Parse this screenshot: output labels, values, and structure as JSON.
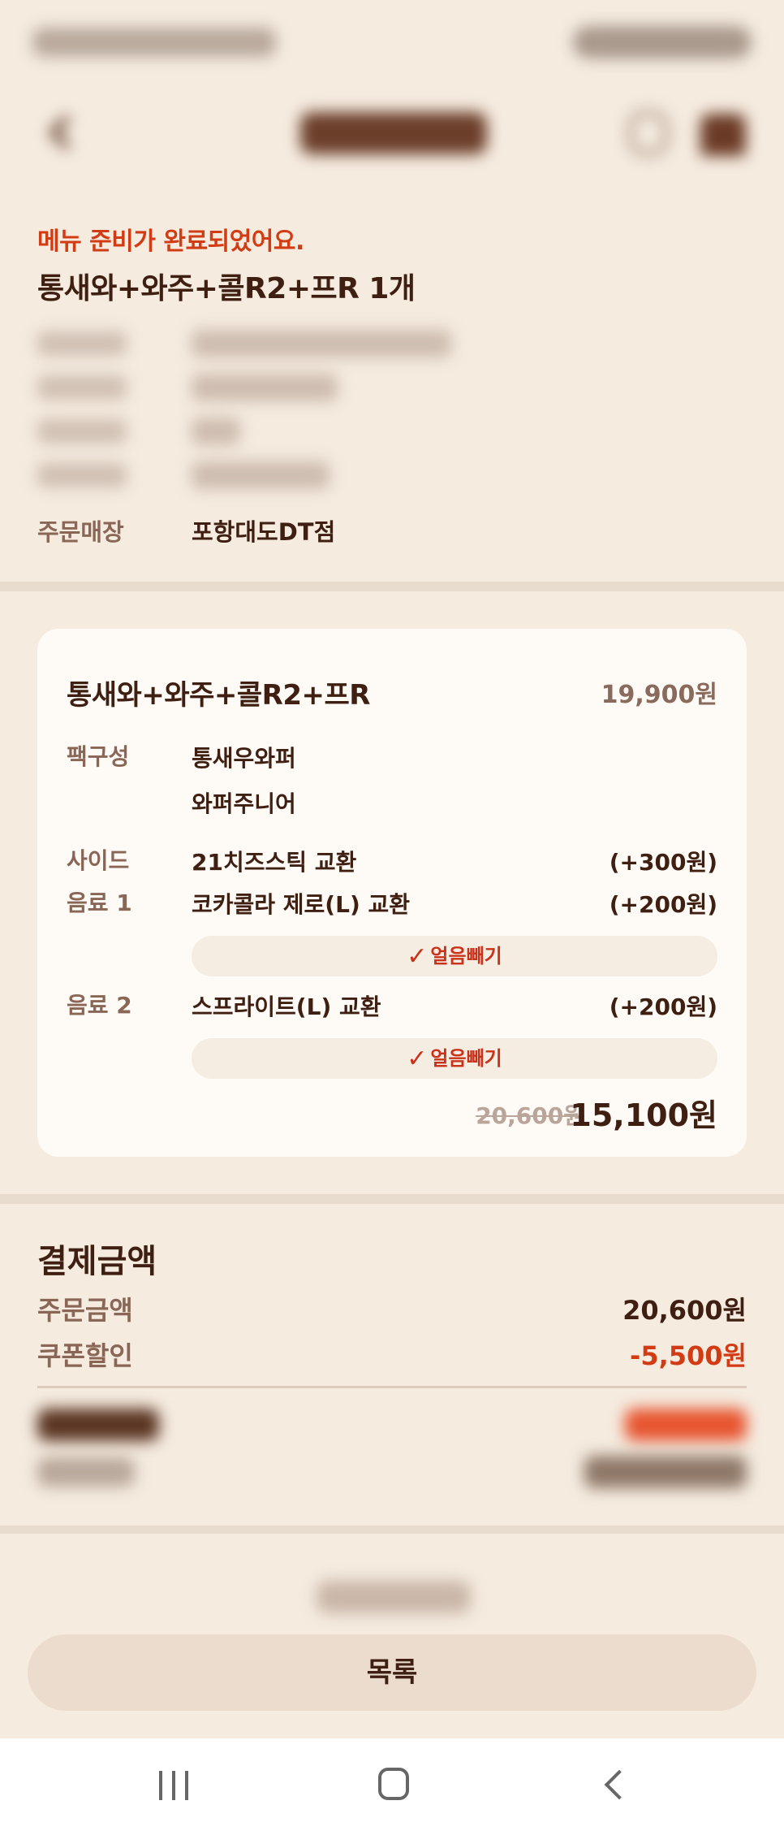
{
  "message": {
    "ready": "메뉴 준비가 완료되었어요.",
    "order_summary": "통새와+와주+콜R2+프R 1개"
  },
  "store": {
    "label": "주문매장",
    "value": "포항대도DT점"
  },
  "item": {
    "name": "통새와+와주+콜R2+프R",
    "price": "19,900원",
    "pack_label": "팩구성",
    "pack_items": [
      "통새우와퍼",
      "와퍼주니어"
    ],
    "side_label": "사이드",
    "side_value": "21치즈스틱 교환",
    "side_add": "(+300원)",
    "drink1_label": "음료 1",
    "drink1_value": "코카콜라 제로(L) 교환",
    "drink1_add": "(+200원)",
    "drink1_option": "얼음빼기",
    "drink2_label": "음료 2",
    "drink2_value": "스프라이트(L) 교환",
    "drink2_add": "(+200원)",
    "drink2_option": "얼음빼기",
    "original_price": "20,600원",
    "final_price": "15,100원"
  },
  "payment": {
    "title": "결제금액",
    "order_amount_label": "주문금액",
    "order_amount_value": "20,600원",
    "coupon_label": "쿠폰할인",
    "coupon_value": "-5,500원"
  },
  "buttons": {
    "list": "목록"
  },
  "icons": {
    "check": "✓"
  }
}
